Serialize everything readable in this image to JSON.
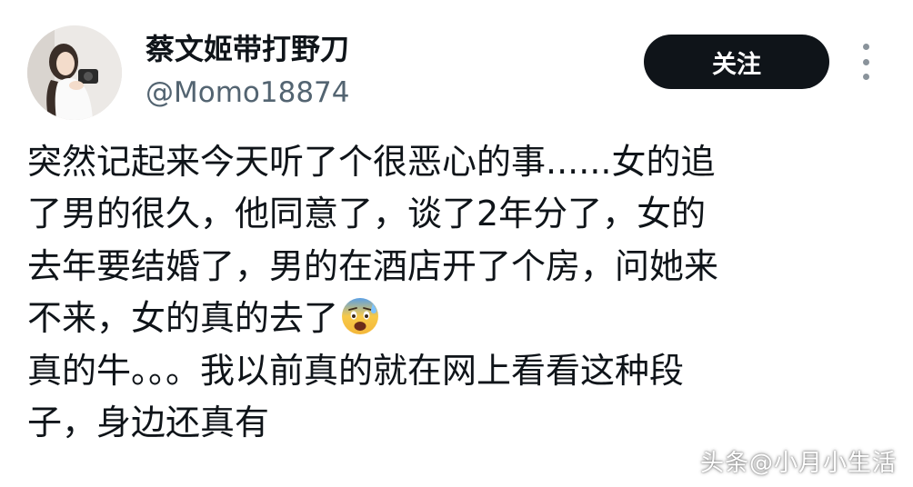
{
  "author": {
    "display_name": "蔡文姬带打野刀",
    "handle": "@Momo18874"
  },
  "follow_button": {
    "label": "关注"
  },
  "more_menu": {
    "icon": "more-vertical-icon"
  },
  "tweet": {
    "lines": [
      "突然记起来今天听了个很恶心的事......女的追",
      "了男的很久，他同意了，谈了2年分了，女的",
      "去年要结婚了，男的在酒店开了个房，问她来",
      "不来，女的真的去了",
      "真的牛。。。我以前真的就在网上看看这种段",
      "子，身边还真有"
    ],
    "emoji": "anxious-face-with-sweat-emoji"
  },
  "watermark": {
    "text": "头条@小月小生活"
  },
  "colors": {
    "background": "#ffffff",
    "text_primary": "#0f1419",
    "text_secondary": "#536471",
    "button_bg": "#0f1419",
    "button_text": "#ffffff"
  }
}
